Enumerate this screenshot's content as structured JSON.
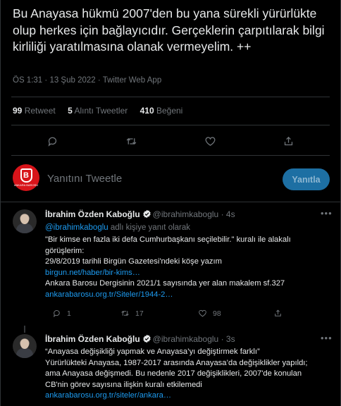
{
  "main_tweet": {
    "text": "Bu Anayasa hükmü 2007'den bu yana sürekli yürürlükte olup herkes için bağlayıcıdır. Gerçeklerin çarpıtılarak bilgi kirliliği yaratılmasına olanak vermeyelim. ++",
    "time": "ÖS 1:31",
    "date": "13 Şub 2022",
    "source": "Twitter Web App",
    "stats": {
      "retweets": "99",
      "retweets_label": "Retweet",
      "quotes": "5",
      "quotes_label": "Alıntı Tweetler",
      "likes": "410",
      "likes_label": "Beğeni"
    }
  },
  "reply_box": {
    "avatar_text": "B",
    "avatar_subtext": "ANKARA BAROSU",
    "placeholder": "Yanıtını Tweetle",
    "button_label": "Yanıtla"
  },
  "replies": [
    {
      "name": "İbrahim Özden Kaboğlu",
      "handle": "@ibrahimkaboglu",
      "time": "4s",
      "replying_handle": "@ibrahimkaboglu",
      "replying_suffix": "adlı kişiye yanıt olarak",
      "lines": [
        "\"Bir kimse en fazla iki defa Cumhurbaşkanı seçilebilir.\" kuralı ile alakalı",
        "görüşlerim:",
        "29/8/2019 tarihli Birgün Gazetesi'ndeki köşe yazım"
      ],
      "link1": "birgun.net/haber/bir-kims…",
      "line4": "Ankara Barosu Dergisinin 2021/1 sayısında yer alan makalem sf.327",
      "link2": "ankarabarosu.org.tr/Siteler/1944-2…",
      "reply_count": "1",
      "retweet_count": "17",
      "like_count": "98"
    },
    {
      "name": "İbrahim Özden Kaboğlu",
      "handle": "@ibrahimkaboglu",
      "time": "3s",
      "lines": [
        "“Anayasa değişikliği yapmak ve Anayasa’yı değiştirmek farklı”",
        "Yürürlükteki Anayasa, 1987-2017 arasında Anayasa’da değişiklikler yapıldı;",
        "ama Anayasa değişmedi. Bu nedenle 2017 değişiklikleri, 2007'de  konulan",
        "CB'nin görev sayısına ilişkin kuralı etkilemedi"
      ],
      "link1": "ankarabarosu.org.tr/siteler/ankara…"
    }
  ],
  "colors": {
    "background": "#000000",
    "text": "#e7e9ea",
    "muted": "#71767b",
    "link": "#1d9bf0",
    "reply_button": "#1d6fa3",
    "badge_red": "#d7141a"
  }
}
